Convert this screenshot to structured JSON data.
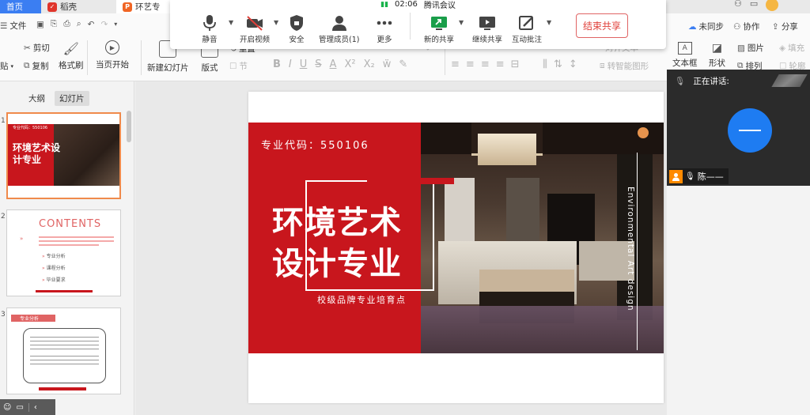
{
  "tabs": [
    {
      "label": "首页"
    },
    {
      "label": "稻壳"
    },
    {
      "label": "环艺专"
    }
  ],
  "ribbon": {
    "file_label": "文件",
    "cut_label": "剪切",
    "paste_label": "贴",
    "copy_label": "复制",
    "format_painter_label": "格式刷",
    "play_label": "当页开始",
    "new_slide_label": "新建幻灯片",
    "layout_label": "版式",
    "reset_label": "重置",
    "section_label": "节",
    "smart_shape_label": "转智能图形",
    "align_text_label": "对齐文本",
    "text_box_label": "文本框",
    "shape_label": "形状",
    "picture_label": "图片",
    "arrange_label": "排列",
    "fill_label": "填充",
    "outline_label": "轮廓"
  },
  "meeting": {
    "time": "02:06",
    "title": "腾讯会议",
    "buttons": [
      {
        "label": "静音",
        "icon": "microphone-icon"
      },
      {
        "label": "开启视频",
        "icon": "camera-off-icon"
      },
      {
        "label": "安全",
        "icon": "shield-icon"
      },
      {
        "label": "管理成员(1)",
        "icon": "members-icon"
      },
      {
        "label": "更多",
        "icon": "more-icon"
      },
      {
        "label": "新的共享",
        "icon": "share-icon"
      },
      {
        "label": "继续共享",
        "icon": "continue-share-icon"
      },
      {
        "label": "互动批注",
        "icon": "annotate-icon"
      }
    ],
    "end_share_label": "结束共享"
  },
  "top_right": {
    "sync_label": "未同步",
    "collab_label": "协作",
    "share_label": "分享"
  },
  "left_panel": {
    "tab_outline": "大纲",
    "tab_slides": "幻灯片",
    "slides": [
      {
        "number": "1",
        "title": "环境艺术设计专业",
        "code": "专业代码：550106"
      },
      {
        "number": "2",
        "title": "CONTENTS",
        "items": [
          "专业分析",
          "课程分析",
          "毕业要求"
        ]
      },
      {
        "number": "3",
        "title": "专业分析"
      }
    ]
  },
  "slide": {
    "code": "专业代码：550106",
    "title_line1": "环境艺术",
    "title_line2": "设计专业",
    "tagline": "校级品牌专业培育点",
    "vertical_text": "Environmental Art design",
    "accent_color": "#c8161d"
  },
  "speaker": {
    "label": "正在讲话:",
    "name": "陈——",
    "avatar_color": "#1e7cf2"
  }
}
